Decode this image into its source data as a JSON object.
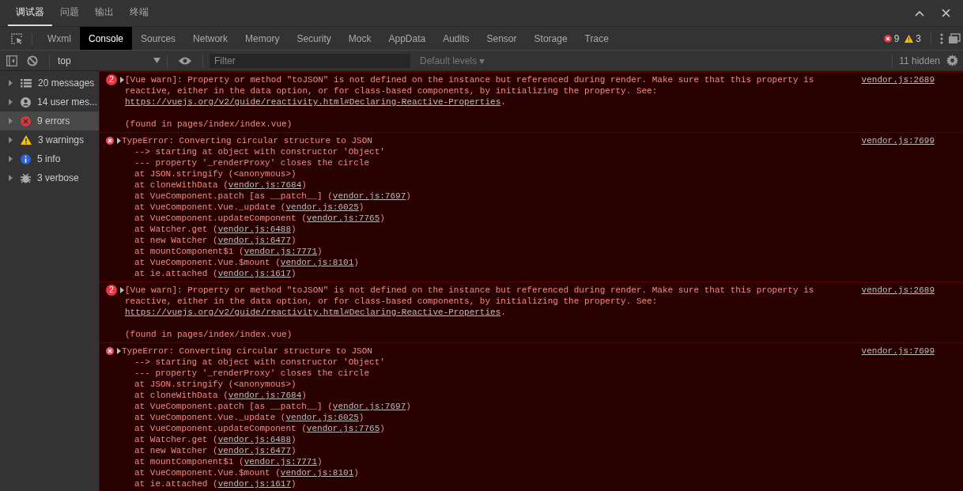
{
  "panel_tabs": [
    {
      "label": "调试器",
      "selected": true
    },
    {
      "label": "问题",
      "selected": false
    },
    {
      "label": "输出",
      "selected": false
    },
    {
      "label": "终端",
      "selected": false
    }
  ],
  "devtools_tabs": [
    {
      "label": "Wxml",
      "selected": false
    },
    {
      "label": "Console",
      "selected": true
    },
    {
      "label": "Sources",
      "selected": false
    },
    {
      "label": "Network",
      "selected": false
    },
    {
      "label": "Memory",
      "selected": false
    },
    {
      "label": "Security",
      "selected": false
    },
    {
      "label": "Mock",
      "selected": false
    },
    {
      "label": "AppData",
      "selected": false
    },
    {
      "label": "Audits",
      "selected": false
    },
    {
      "label": "Sensor",
      "selected": false
    },
    {
      "label": "Storage",
      "selected": false
    },
    {
      "label": "Trace",
      "selected": false
    }
  ],
  "counters": {
    "errors": "9",
    "warnings": "3"
  },
  "toolbar": {
    "context": "top",
    "filter_placeholder": "Filter",
    "levels": "Default levels",
    "hidden": "11 hidden"
  },
  "sidebar": [
    {
      "kind": "messages",
      "label": "20 messages",
      "selected": false
    },
    {
      "kind": "user",
      "label": "14 user mes...",
      "selected": false
    },
    {
      "kind": "errors",
      "label": "9 errors",
      "selected": true
    },
    {
      "kind": "warnings",
      "label": "3 warnings",
      "selected": false
    },
    {
      "kind": "info",
      "label": "5 info",
      "selected": false
    },
    {
      "kind": "verbose",
      "label": "3 verbose",
      "selected": false
    }
  ],
  "messages": [
    {
      "kind": "repeated",
      "count": "2",
      "source": "vendor.js:2689",
      "text": "[Vue warn]: Property or method \"toJSON\" is not defined on the instance but referenced during render. Make sure that this property is reactive, either in the data option, or for class-based components, by initializing the property. See: ",
      "link": "https://vuejs.org/v2/guide/reactivity.html#Declaring-Reactive-Properties",
      "end": ".",
      "found": "(found in pages/index/index.vue)"
    },
    {
      "kind": "error",
      "source": "vendor.js:7699",
      "text": "TypeError: Converting circular structure to JSON",
      "stack": [
        {
          "text": "--> starting at object with constructor 'Object'"
        },
        {
          "text": "--- property '_renderProxy' closes the circle"
        },
        {
          "text": "at JSON.stringify (<anonymous>)"
        },
        {
          "text": "at cloneWithData (",
          "link": "vendor.js:7684",
          "end": ")"
        },
        {
          "text": "at VueComponent.patch [as __patch__] (",
          "link": "vendor.js:7697",
          "end": ")"
        },
        {
          "text": "at VueComponent.Vue._update (",
          "link": "vendor.js:6025",
          "end": ")"
        },
        {
          "text": "at VueComponent.updateComponent (",
          "link": "vendor.js:7765",
          "end": ")"
        },
        {
          "text": "at Watcher.get (",
          "link": "vendor.js:6488",
          "end": ")"
        },
        {
          "text": "at new Watcher (",
          "link": "vendor.js:6477",
          "end": ")"
        },
        {
          "text": "at mountComponent$1 (",
          "link": "vendor.js:7771",
          "end": ")"
        },
        {
          "text": "at VueComponent.Vue.$mount (",
          "link": "vendor.js:8101",
          "end": ")"
        },
        {
          "text": "at ie.attached (",
          "link": "vendor.js:1617",
          "end": ")"
        }
      ]
    },
    {
      "kind": "repeated",
      "count": "2",
      "source": "vendor.js:2689",
      "text": "[Vue warn]: Property or method \"toJSON\" is not defined on the instance but referenced during render. Make sure that this property is reactive, either in the data option, or for class-based components, by initializing the property. See: ",
      "link": "https://vuejs.org/v2/guide/reactivity.html#Declaring-Reactive-Properties",
      "end": ".",
      "found": "(found in pages/index/index.vue)"
    },
    {
      "kind": "error",
      "source": "vendor.js:7699",
      "text": "TypeError: Converting circular structure to JSON",
      "stack": [
        {
          "text": "--> starting at object with constructor 'Object'"
        },
        {
          "text": "--- property '_renderProxy' closes the circle"
        },
        {
          "text": "at JSON.stringify (<anonymous>)"
        },
        {
          "text": "at cloneWithData (",
          "link": "vendor.js:7684",
          "end": ")"
        },
        {
          "text": "at VueComponent.patch [as __patch__] (",
          "link": "vendor.js:7697",
          "end": ")"
        },
        {
          "text": "at VueComponent.Vue._update (",
          "link": "vendor.js:6025",
          "end": ")"
        },
        {
          "text": "at VueComponent.updateComponent (",
          "link": "vendor.js:7765",
          "end": ")"
        },
        {
          "text": "at Watcher.get (",
          "link": "vendor.js:6488",
          "end": ")"
        },
        {
          "text": "at new Watcher (",
          "link": "vendor.js:6477",
          "end": ")"
        },
        {
          "text": "at mountComponent$1 (",
          "link": "vendor.js:7771",
          "end": ")"
        },
        {
          "text": "at VueComponent.Vue.$mount (",
          "link": "vendor.js:8101",
          "end": ")"
        },
        {
          "text": "at ie.attached (",
          "link": "vendor.js:1617",
          "end": ")"
        }
      ]
    }
  ]
}
